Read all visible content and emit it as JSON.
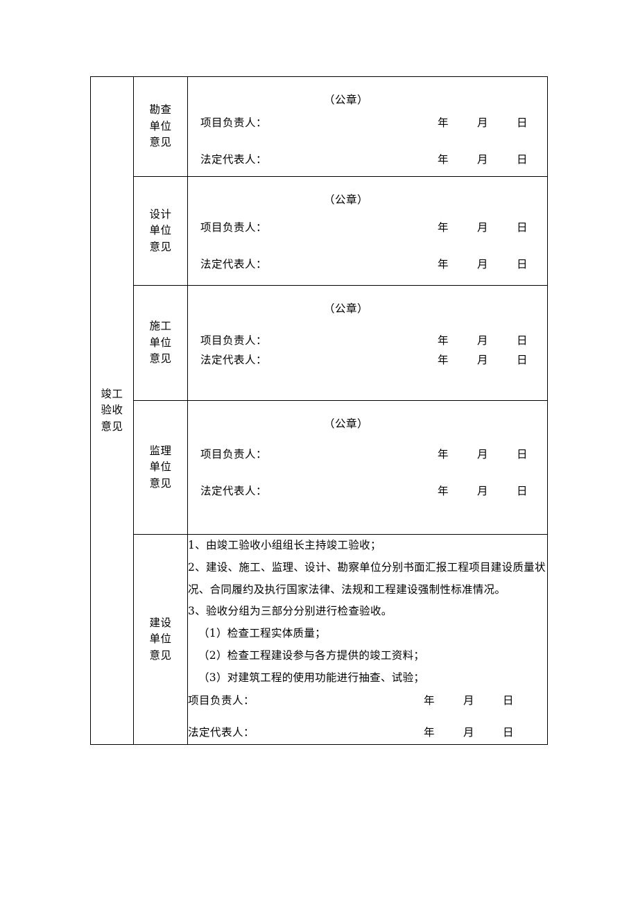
{
  "document": {
    "main_label": "竣工\n验收\n意见",
    "seal_text": "（公章）",
    "project_leader_label": "项目负责人：",
    "legal_rep_label": "法定代表人：",
    "date_year": "年",
    "date_month": "月",
    "date_day": "日"
  },
  "sections": [
    {
      "unit_label": "勘查\n单位\n意见",
      "seal": "（公章）",
      "signatures": [
        {
          "label": "项目负责人：",
          "year": "年",
          "month": "月",
          "day": "日"
        },
        {
          "label": "法定代表人：",
          "year": "年",
          "month": "月",
          "day": "日"
        }
      ]
    },
    {
      "unit_label": "设计\n单位\n意见",
      "seal": "（公章）",
      "signatures": [
        {
          "label": "项目负责人：",
          "year": "年",
          "month": "月",
          "day": "日"
        },
        {
          "label": "法定代表人：",
          "year": "年",
          "month": "月",
          "day": "日"
        }
      ]
    },
    {
      "unit_label": "施工\n单位\n意见",
      "seal": "（公章）",
      "signatures": [
        {
          "label": "项目负责人：",
          "year": "年",
          "month": "月",
          "day": "日"
        },
        {
          "label": "法定代表人：",
          "year": "年",
          "month": "月",
          "day": "日"
        }
      ]
    },
    {
      "unit_label": "监理\n单位\n意见",
      "seal": "（公章）",
      "signatures": [
        {
          "label": "项目负责人：",
          "year": "年",
          "month": "月",
          "day": "日"
        },
        {
          "label": "法定代表人：",
          "year": "年",
          "month": "月",
          "day": "日"
        }
      ]
    }
  ],
  "construction_unit": {
    "unit_label": "建设\n单位\n意见",
    "notes": [
      "1、由竣工验收小组组长主持竣工验收；",
      "2、建设、施工、监理、设计、勘察单位分别书面汇报工程项目建设质量状况、合同履约及执行国家法律、法规和工程建设强制性标准情况。",
      "3、验收分组为三部分分别进行检查验收。"
    ],
    "sub_notes": [
      "（1）检查工程实体质量；",
      "（2）检查工程建设参与各方提供的竣工资料；",
      "（3）对建筑工程的使用功能进行抽查、试验；"
    ],
    "signatures": [
      {
        "label": "项目负责人：",
        "year": "年",
        "month": "月",
        "day": "日"
      },
      {
        "label": "法定代表人：",
        "year": "年",
        "month": "月",
        "day": "日"
      }
    ]
  }
}
